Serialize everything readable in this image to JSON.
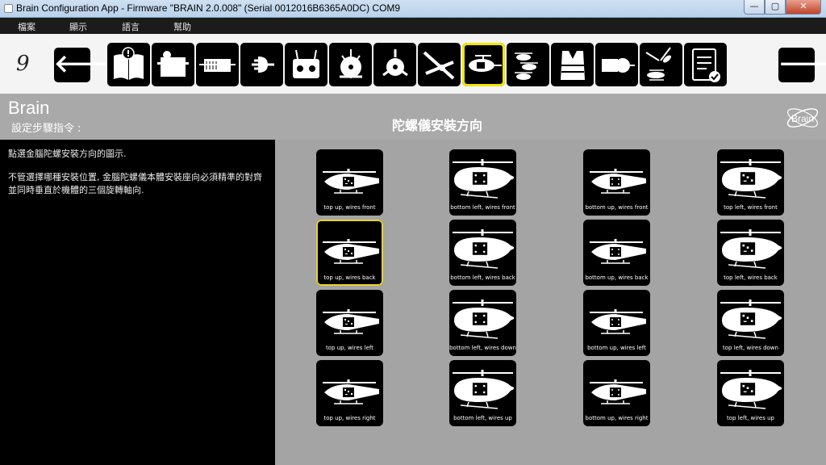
{
  "window": {
    "title": "Brain Configuration App - Firmware \"BRAIN 2.0.008\" (Serial 0012016B6365A0DC)  COM9",
    "controls": [
      "—",
      "▢",
      "✕"
    ]
  },
  "menu": [
    "檔案",
    "顯示",
    "語言",
    "幫助"
  ],
  "toolbar": {
    "step": "9",
    "prev_icon": "arrow-left-icon",
    "next_icon": "arrow-right-icon",
    "tools": [
      {
        "icon": "manual-book-icon"
      },
      {
        "icon": "servo-icon"
      },
      {
        "icon": "servo-linkage-icon"
      },
      {
        "icon": "plug-icon"
      },
      {
        "icon": "transmitter-icon"
      },
      {
        "icon": "swashplate-icon"
      },
      {
        "icon": "swashplate-three-point-icon"
      },
      {
        "icon": "tail-rotor-icon"
      },
      {
        "icon": "gyro-orientation-icon",
        "active": true
      },
      {
        "icon": "flight-modes-icon"
      },
      {
        "icon": "safety-vest-icon"
      },
      {
        "icon": "motor-governor-icon"
      },
      {
        "icon": "advanced-tuning-icon"
      },
      {
        "icon": "checklist-icon"
      }
    ]
  },
  "header": {
    "brand": "Brain",
    "subtitle": "設定步驟指令 :",
    "title": "陀螺儀安裝方向",
    "logo_text": "Brain"
  },
  "info": {
    "line1": "點選金腦陀螺安裝方向的圖示.",
    "line2": "不管選擇哪種安裝位置, 金腦陀螺儀本體安裝座向必須精準的對齊並同時垂直於機體的三個旋轉軸向."
  },
  "orientations": [
    {
      "label": "top up, wires front",
      "view": "side",
      "chip": "top"
    },
    {
      "label": "bottom left, wires front",
      "view": "front",
      "chip": "bottom"
    },
    {
      "label": "bottom up, wires front",
      "view": "side",
      "chip": "bottom"
    },
    {
      "label": "top left, wires front",
      "view": "front",
      "chip": "top"
    },
    {
      "label": "top up, wires back",
      "view": "side",
      "chip": "top",
      "selected": true
    },
    {
      "label": "bottom left, wires back",
      "view": "front",
      "chip": "bottom"
    },
    {
      "label": "bottom up, wires back",
      "view": "side",
      "chip": "bottom"
    },
    {
      "label": "top left, wires back",
      "view": "front",
      "chip": "top"
    },
    {
      "label": "top up, wires left",
      "view": "side",
      "chip": "top"
    },
    {
      "label": "bottom left, wires down",
      "view": "front",
      "chip": "bottom"
    },
    {
      "label": "bottom up, wires left",
      "view": "side",
      "chip": "bottom"
    },
    {
      "label": "top left, wires down",
      "view": "front",
      "chip": "top"
    },
    {
      "label": "top up, wires right",
      "view": "side",
      "chip": "top"
    },
    {
      "label": "bottom left, wires up",
      "view": "front",
      "chip": "bottom"
    },
    {
      "label": "bottom up, wires right",
      "view": "side",
      "chip": "bottom"
    },
    {
      "label": "top left, wires up",
      "view": "front",
      "chip": "top"
    }
  ],
  "colors": {
    "accent": "#f0e600",
    "header_band": "#a9a9a9",
    "grid_bg": "#a4a4a4"
  }
}
